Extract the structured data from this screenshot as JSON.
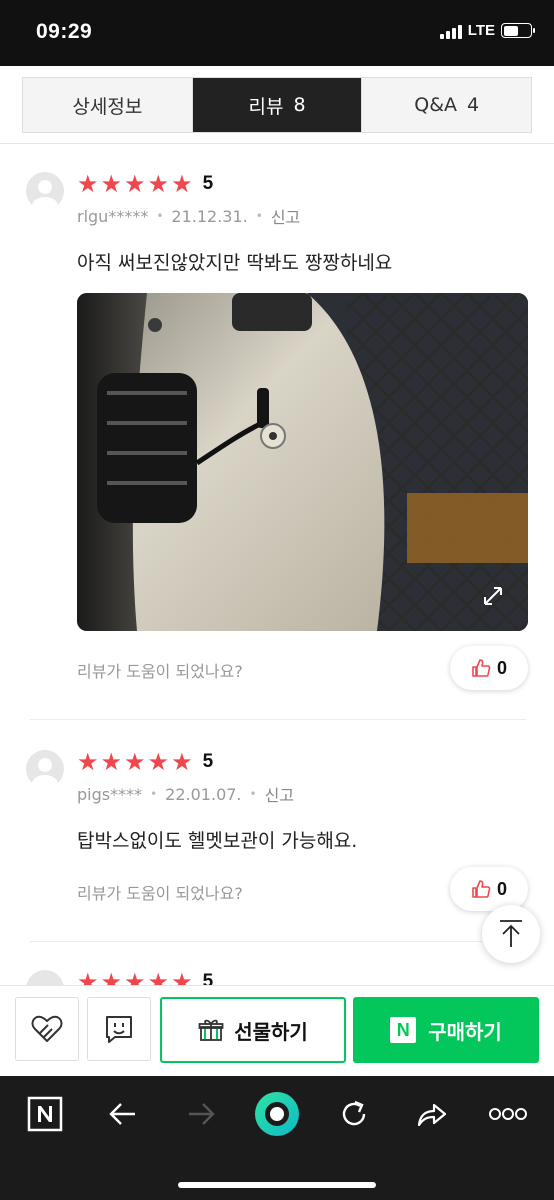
{
  "status_bar": {
    "time": "09:29",
    "network": "LTE"
  },
  "tabs": [
    {
      "label": "상세정보",
      "count": ""
    },
    {
      "label": "리뷰",
      "count": "8"
    },
    {
      "label": "Q&A",
      "count": "4"
    }
  ],
  "reviews": [
    {
      "rating": "5",
      "user": "rlgu*****",
      "date": "21.12.31.",
      "report": "신고",
      "text": "아직 써보진않았지만 딱봐도 짱짱하네요",
      "helpful_question": "리뷰가 도움이 되었나요?",
      "likes": "0"
    },
    {
      "rating": "5",
      "user": "pigs****",
      "date": "22.01.07.",
      "report": "신고",
      "text": "탑박스없이도 헬멧보관이 가능해요.",
      "helpful_question": "리뷰가 도움이 되었나요?",
      "likes": "0"
    },
    {
      "rating": "5"
    }
  ],
  "buy_bar": {
    "gift_label": "선물하기",
    "buy_label": "구매하기",
    "buy_badge": "N"
  },
  "colors": {
    "star": "#f0474e",
    "naver_green": "#03c75a",
    "tab_active": "#222222"
  },
  "icons": [
    "heart-icon",
    "talk-icon",
    "gift-icon",
    "naver-n-icon",
    "thumbs-up-icon",
    "expand-icon",
    "arrow-up-icon",
    "back-icon",
    "forward-icon",
    "refresh-icon",
    "share-icon",
    "more-icon"
  ]
}
